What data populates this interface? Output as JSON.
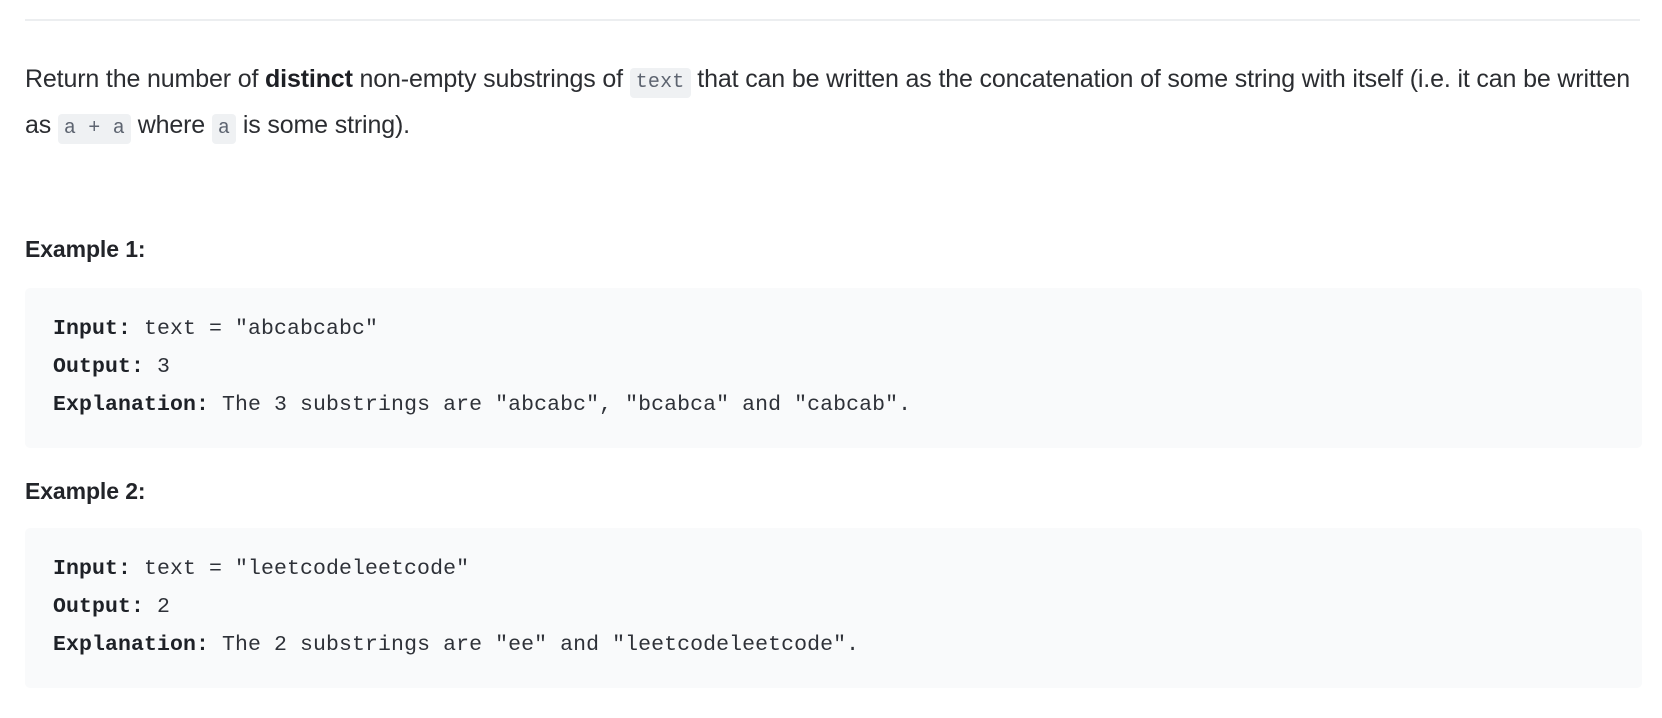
{
  "problem": {
    "description": {
      "part1": "Return the number of ",
      "bold1": "distinct",
      "part2": " non-empty substrings of ",
      "code1": "text",
      "part3": " that can be written as the concatenation of some string with itself (i.e. it can be written as ",
      "code2": "a + a",
      "part4": " where ",
      "code3": "a",
      "part5": " is some string)."
    },
    "examples": [
      {
        "title": "Example 1:",
        "input_label": "Input:",
        "input_value": " text = \"abcabcabc\"",
        "output_label": "Output:",
        "output_value": " 3",
        "explanation_label": "Explanation:",
        "explanation_value": " The 3 substrings are \"abcabc\", \"bcabca\" and \"cabcab\"."
      },
      {
        "title": "Example 2:",
        "input_label": "Input:",
        "input_value": " text = \"leetcodeleetcode\"",
        "output_label": "Output:",
        "output_value": " 2",
        "explanation_label": "Explanation:",
        "explanation_value": " The 2 substrings are \"ee\" and \"leetcodeleetcode\"."
      }
    ]
  },
  "colors": {
    "page_background": "#ffffff",
    "text": "#2b2d31",
    "code_block_background": "#f9fafb",
    "inline_code_background": "#eff1f3",
    "inline_code_text": "#5d6470",
    "divider": "#eceef0"
  }
}
